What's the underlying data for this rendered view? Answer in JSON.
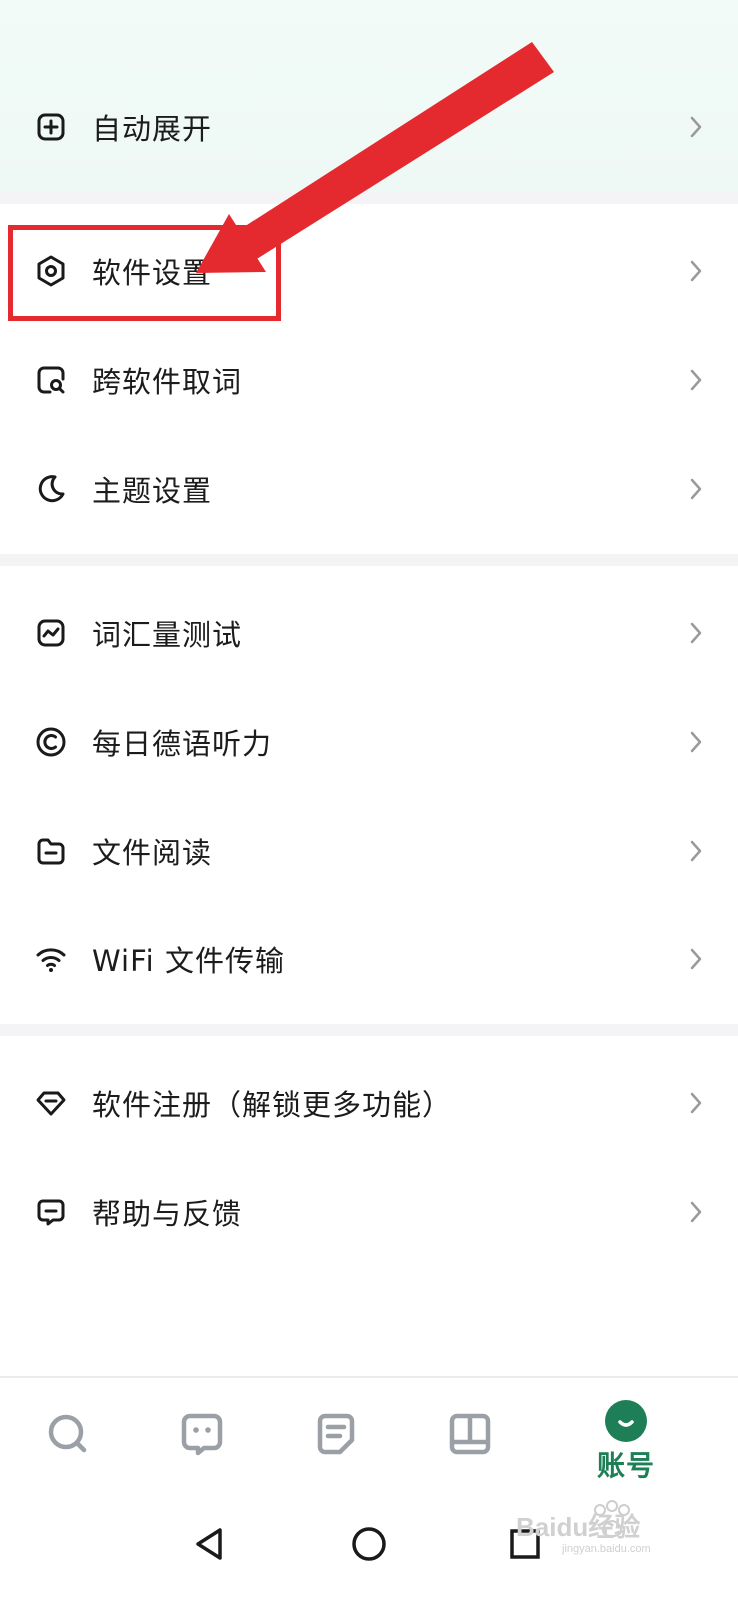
{
  "menu": {
    "auto_expand": "自动展开",
    "software_settings": "软件设置",
    "cross_app_lookup": "跨软件取词",
    "theme_settings": "主题设置",
    "vocab_test": "词汇量测试",
    "daily_listening": "每日德语听力",
    "file_reading": "文件阅读",
    "wifi_transfer": "WiFi 文件传输",
    "software_register": "软件注册（解锁更多功能）",
    "help_feedback": "帮助与反馈"
  },
  "tabbar": {
    "tabs": [
      {
        "icon": "search-icon"
      },
      {
        "icon": "chat-icon"
      },
      {
        "icon": "notes-icon"
      },
      {
        "icon": "book-icon"
      },
      {
        "icon": "avatar-icon",
        "label": "账号",
        "active": true
      }
    ]
  },
  "navbar": {
    "buttons": [
      "back-triangle-icon",
      "home-circle-icon",
      "recents-square-icon"
    ]
  },
  "watermark": {
    "text": "Baidu经验",
    "subtext": "jingyan.baidu.com"
  },
  "colors": {
    "accent": "#1e7f56",
    "annotation_red": "#e52a2f",
    "section_gap": "#f4f4f6"
  }
}
